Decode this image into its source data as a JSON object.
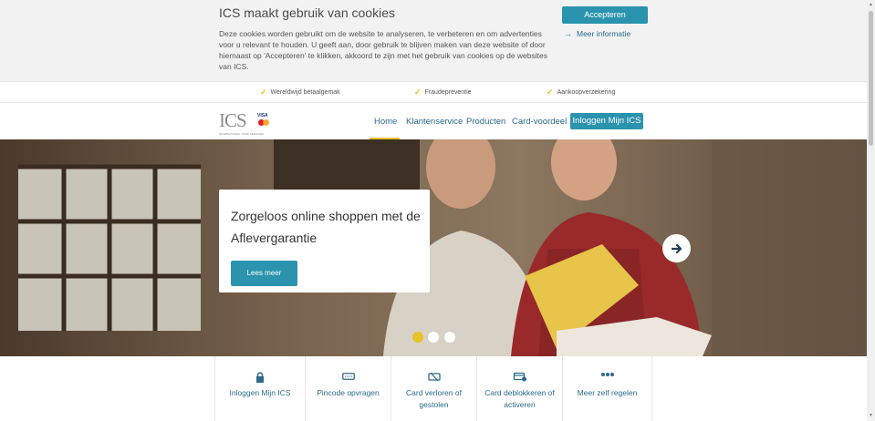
{
  "cookie": {
    "title": "ICS maakt gebruik van cookies",
    "text": "Deze cookies worden gebruikt om de website te analyseren, te verbeteren en om advertenties voor u relevant te houden. U geeft aan, door gebruik te blijven maken van deze website of door hiernaast op 'Accepteren' te klikken, akkoord te zijn met het gebruik van cookies op de websites van ICS.",
    "accept_label": "Accepteren",
    "more_label": "Meer informatie"
  },
  "usps": [
    {
      "label": "Wereldwijd betaalgemak"
    },
    {
      "label": "Fraudepreventie"
    },
    {
      "label": "Aankoopverzekering"
    }
  ],
  "logo": {
    "text": "ICS",
    "visa": "VISA",
    "subtitle": "INTERNATIONAL CARD SERVICES"
  },
  "nav": {
    "items": [
      {
        "label": "Home"
      },
      {
        "label": "Klantenservice"
      },
      {
        "label": "Producten"
      },
      {
        "label": "Card-voordeel"
      }
    ],
    "active": "Home",
    "login_label": "Inloggen Mijn ICS"
  },
  "hero": {
    "title": "Zorgeloos online shoppen met de Aflevergarantie",
    "button_label": "Lees meer",
    "slide_count": 3,
    "active_slide": 1
  },
  "quick_links": [
    {
      "label": "Inloggen Mijn ICS",
      "icon": "lock-icon"
    },
    {
      "label": "Pincode opvragen",
      "icon": "pincode-icon"
    },
    {
      "label": "Card verloren of gestolen",
      "icon": "lost-card-icon"
    },
    {
      "label": "Card deblokkeren of activeren",
      "icon": "card-unlock-icon"
    },
    {
      "label": "Meer zelf regelen",
      "icon": "more-dots-icon"
    }
  ],
  "colors": {
    "accent": "#2a93ad",
    "link": "#2b6a88",
    "highlight": "#e8c227",
    "cookie_bg": "#f2f2f2"
  }
}
